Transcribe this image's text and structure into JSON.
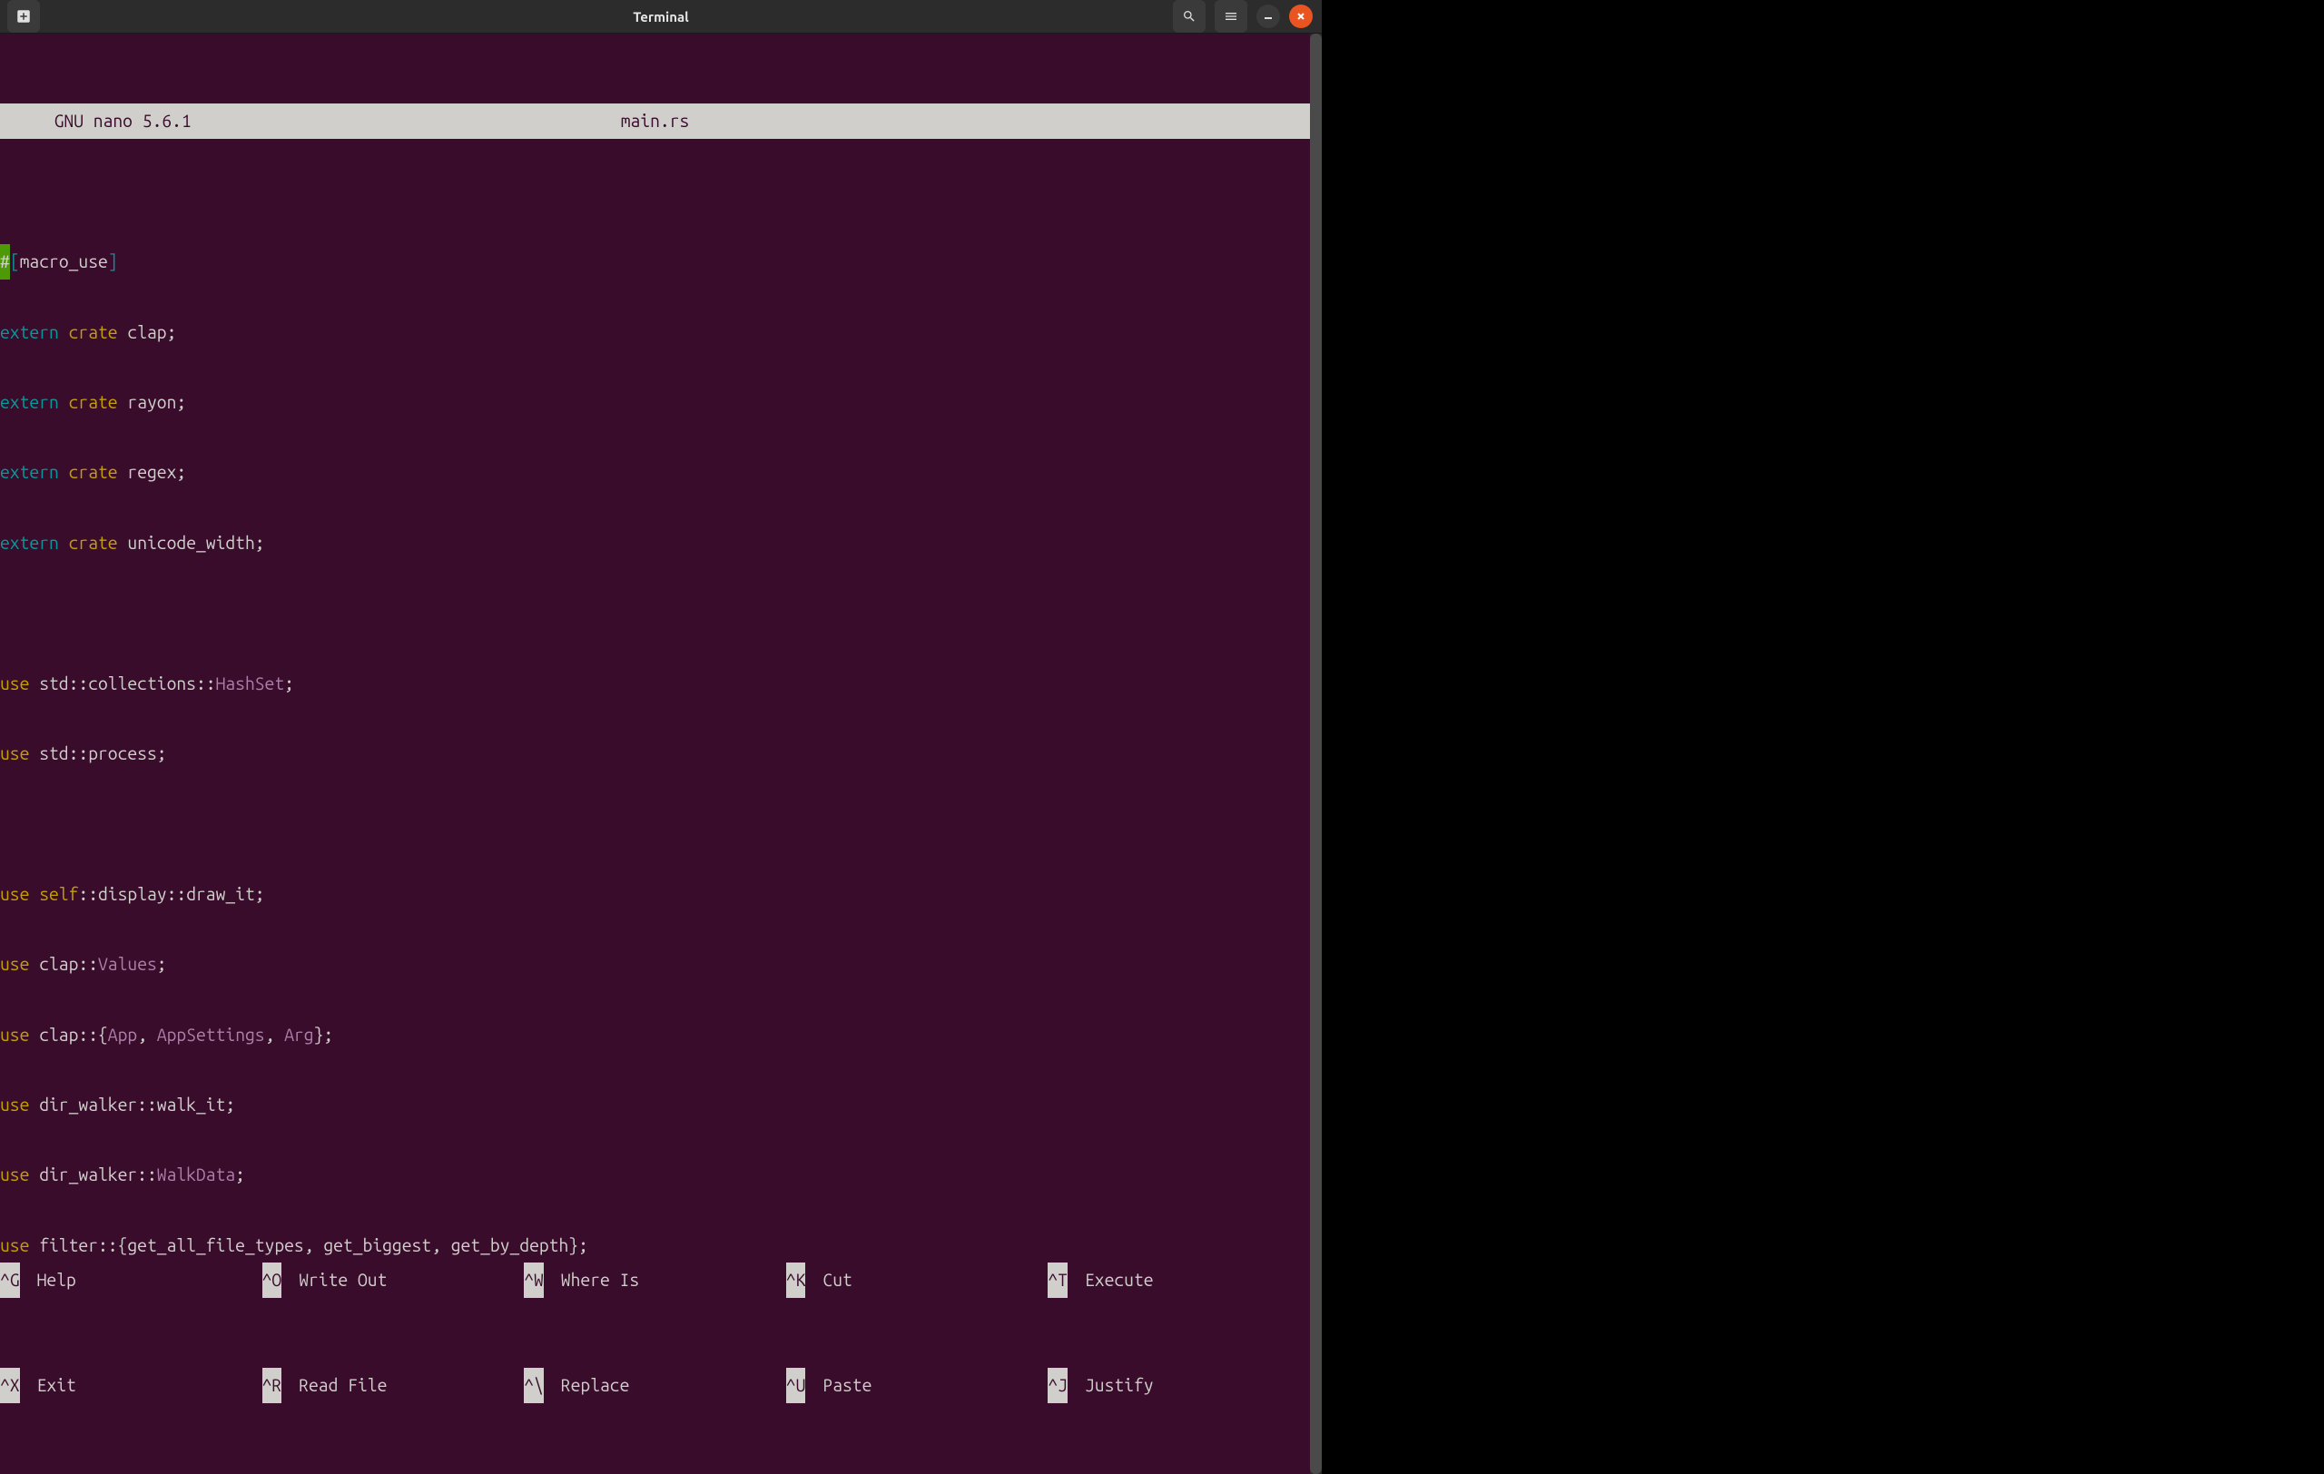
{
  "window": {
    "title": "Terminal"
  },
  "nano": {
    "app_name": "  GNU nano 5.6.1",
    "filename": "main.rs"
  },
  "code": {
    "l1": {
      "a": "#",
      "b": "[",
      "c": "macro_use",
      "d": "]"
    },
    "l2": {
      "a": "extern",
      "b": " ",
      "c": "crate",
      "d": " clap;"
    },
    "l3": {
      "a": "extern",
      "b": " ",
      "c": "crate",
      "d": " rayon;"
    },
    "l4": {
      "a": "extern",
      "b": " ",
      "c": "crate",
      "d": " regex;"
    },
    "l5": {
      "a": "extern",
      "b": " ",
      "c": "crate",
      "d": " unicode_width;"
    },
    "l6": "",
    "l7": {
      "a": "use",
      "b": " std::collections::",
      "c": "HashSet",
      "d": ";"
    },
    "l8": {
      "a": "use",
      "b": " std::process;"
    },
    "l9": "",
    "l10": {
      "a": "use",
      "b": " ",
      "c": "self",
      "d": "::display::draw_it;"
    },
    "l11": {
      "a": "use",
      "b": " clap::",
      "c": "Values",
      "d": ";"
    },
    "l12": {
      "a": "use",
      "b": " clap::{",
      "c": "App",
      "d": ", ",
      "e": "AppSettings",
      "f": ", ",
      "g": "Arg",
      "h": "};"
    },
    "l13": {
      "a": "use",
      "b": " dir_walker::walk_it;"
    },
    "l14": {
      "a": "use",
      "b": " dir_walker::",
      "c": "WalkData",
      "d": ";"
    },
    "l15": {
      "a": "use",
      "b": " filter::{get_all_file_types, get_biggest, get_by_depth};"
    }
  },
  "shortcuts": {
    "row1": [
      {
        "key": "^G",
        "label": "Help"
      },
      {
        "key": "^O",
        "label": "Write Out"
      },
      {
        "key": "^W",
        "label": "Where Is"
      },
      {
        "key": "^K",
        "label": "Cut"
      },
      {
        "key": "^T",
        "label": "Execute"
      }
    ],
    "row2": [
      {
        "key": "^X",
        "label": "Exit"
      },
      {
        "key": "^R",
        "label": "Read File"
      },
      {
        "key": "^\\",
        "label": "Replace"
      },
      {
        "key": "^U",
        "label": "Paste"
      },
      {
        "key": "^J",
        "label": "Justify"
      }
    ]
  }
}
